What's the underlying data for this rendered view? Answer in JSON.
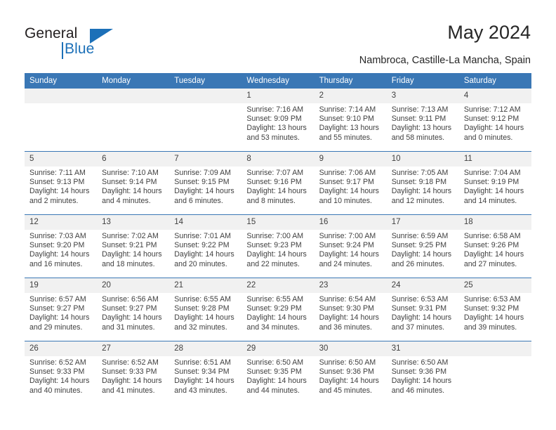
{
  "brand": {
    "name_part1": "General",
    "name_part2": "Blue"
  },
  "header": {
    "title": "May 2024",
    "subtitle": "Nambroca, Castille-La Mancha, Spain"
  },
  "colors": {
    "header_blue": "#3a77b5",
    "brand_blue": "#1c70b8",
    "daynum_band": "#f1f1f1",
    "text": "#3f3f3f"
  },
  "weekdays": [
    "Sunday",
    "Monday",
    "Tuesday",
    "Wednesday",
    "Thursday",
    "Friday",
    "Saturday"
  ],
  "labels": {
    "sunrise_prefix": "Sunrise:",
    "sunset_prefix": "Sunset:",
    "daylight_prefix": "Daylight:"
  },
  "weeks": [
    [
      {
        "day": "",
        "empty": true
      },
      {
        "day": "",
        "empty": true
      },
      {
        "day": "",
        "empty": true
      },
      {
        "day": "1",
        "sunrise": "Sunrise: 7:16 AM",
        "sunset": "Sunset: 9:09 PM",
        "daylight1": "Daylight: 13 hours",
        "daylight2": "and 53 minutes."
      },
      {
        "day": "2",
        "sunrise": "Sunrise: 7:14 AM",
        "sunset": "Sunset: 9:10 PM",
        "daylight1": "Daylight: 13 hours",
        "daylight2": "and 55 minutes."
      },
      {
        "day": "3",
        "sunrise": "Sunrise: 7:13 AM",
        "sunset": "Sunset: 9:11 PM",
        "daylight1": "Daylight: 13 hours",
        "daylight2": "and 58 minutes."
      },
      {
        "day": "4",
        "sunrise": "Sunrise: 7:12 AM",
        "sunset": "Sunset: 9:12 PM",
        "daylight1": "Daylight: 14 hours",
        "daylight2": "and 0 minutes."
      }
    ],
    [
      {
        "day": "5",
        "sunrise": "Sunrise: 7:11 AM",
        "sunset": "Sunset: 9:13 PM",
        "daylight1": "Daylight: 14 hours",
        "daylight2": "and 2 minutes."
      },
      {
        "day": "6",
        "sunrise": "Sunrise: 7:10 AM",
        "sunset": "Sunset: 9:14 PM",
        "daylight1": "Daylight: 14 hours",
        "daylight2": "and 4 minutes."
      },
      {
        "day": "7",
        "sunrise": "Sunrise: 7:09 AM",
        "sunset": "Sunset: 9:15 PM",
        "daylight1": "Daylight: 14 hours",
        "daylight2": "and 6 minutes."
      },
      {
        "day": "8",
        "sunrise": "Sunrise: 7:07 AM",
        "sunset": "Sunset: 9:16 PM",
        "daylight1": "Daylight: 14 hours",
        "daylight2": "and 8 minutes."
      },
      {
        "day": "9",
        "sunrise": "Sunrise: 7:06 AM",
        "sunset": "Sunset: 9:17 PM",
        "daylight1": "Daylight: 14 hours",
        "daylight2": "and 10 minutes."
      },
      {
        "day": "10",
        "sunrise": "Sunrise: 7:05 AM",
        "sunset": "Sunset: 9:18 PM",
        "daylight1": "Daylight: 14 hours",
        "daylight2": "and 12 minutes."
      },
      {
        "day": "11",
        "sunrise": "Sunrise: 7:04 AM",
        "sunset": "Sunset: 9:19 PM",
        "daylight1": "Daylight: 14 hours",
        "daylight2": "and 14 minutes."
      }
    ],
    [
      {
        "day": "12",
        "sunrise": "Sunrise: 7:03 AM",
        "sunset": "Sunset: 9:20 PM",
        "daylight1": "Daylight: 14 hours",
        "daylight2": "and 16 minutes."
      },
      {
        "day": "13",
        "sunrise": "Sunrise: 7:02 AM",
        "sunset": "Sunset: 9:21 PM",
        "daylight1": "Daylight: 14 hours",
        "daylight2": "and 18 minutes."
      },
      {
        "day": "14",
        "sunrise": "Sunrise: 7:01 AM",
        "sunset": "Sunset: 9:22 PM",
        "daylight1": "Daylight: 14 hours",
        "daylight2": "and 20 minutes."
      },
      {
        "day": "15",
        "sunrise": "Sunrise: 7:00 AM",
        "sunset": "Sunset: 9:23 PM",
        "daylight1": "Daylight: 14 hours",
        "daylight2": "and 22 minutes."
      },
      {
        "day": "16",
        "sunrise": "Sunrise: 7:00 AM",
        "sunset": "Sunset: 9:24 PM",
        "daylight1": "Daylight: 14 hours",
        "daylight2": "and 24 minutes."
      },
      {
        "day": "17",
        "sunrise": "Sunrise: 6:59 AM",
        "sunset": "Sunset: 9:25 PM",
        "daylight1": "Daylight: 14 hours",
        "daylight2": "and 26 minutes."
      },
      {
        "day": "18",
        "sunrise": "Sunrise: 6:58 AM",
        "sunset": "Sunset: 9:26 PM",
        "daylight1": "Daylight: 14 hours",
        "daylight2": "and 27 minutes."
      }
    ],
    [
      {
        "day": "19",
        "sunrise": "Sunrise: 6:57 AM",
        "sunset": "Sunset: 9:27 PM",
        "daylight1": "Daylight: 14 hours",
        "daylight2": "and 29 minutes."
      },
      {
        "day": "20",
        "sunrise": "Sunrise: 6:56 AM",
        "sunset": "Sunset: 9:27 PM",
        "daylight1": "Daylight: 14 hours",
        "daylight2": "and 31 minutes."
      },
      {
        "day": "21",
        "sunrise": "Sunrise: 6:55 AM",
        "sunset": "Sunset: 9:28 PM",
        "daylight1": "Daylight: 14 hours",
        "daylight2": "and 32 minutes."
      },
      {
        "day": "22",
        "sunrise": "Sunrise: 6:55 AM",
        "sunset": "Sunset: 9:29 PM",
        "daylight1": "Daylight: 14 hours",
        "daylight2": "and 34 minutes."
      },
      {
        "day": "23",
        "sunrise": "Sunrise: 6:54 AM",
        "sunset": "Sunset: 9:30 PM",
        "daylight1": "Daylight: 14 hours",
        "daylight2": "and 36 minutes."
      },
      {
        "day": "24",
        "sunrise": "Sunrise: 6:53 AM",
        "sunset": "Sunset: 9:31 PM",
        "daylight1": "Daylight: 14 hours",
        "daylight2": "and 37 minutes."
      },
      {
        "day": "25",
        "sunrise": "Sunrise: 6:53 AM",
        "sunset": "Sunset: 9:32 PM",
        "daylight1": "Daylight: 14 hours",
        "daylight2": "and 39 minutes."
      }
    ],
    [
      {
        "day": "26",
        "sunrise": "Sunrise: 6:52 AM",
        "sunset": "Sunset: 9:33 PM",
        "daylight1": "Daylight: 14 hours",
        "daylight2": "and 40 minutes."
      },
      {
        "day": "27",
        "sunrise": "Sunrise: 6:52 AM",
        "sunset": "Sunset: 9:33 PM",
        "daylight1": "Daylight: 14 hours",
        "daylight2": "and 41 minutes."
      },
      {
        "day": "28",
        "sunrise": "Sunrise: 6:51 AM",
        "sunset": "Sunset: 9:34 PM",
        "daylight1": "Daylight: 14 hours",
        "daylight2": "and 43 minutes."
      },
      {
        "day": "29",
        "sunrise": "Sunrise: 6:50 AM",
        "sunset": "Sunset: 9:35 PM",
        "daylight1": "Daylight: 14 hours",
        "daylight2": "and 44 minutes."
      },
      {
        "day": "30",
        "sunrise": "Sunrise: 6:50 AM",
        "sunset": "Sunset: 9:36 PM",
        "daylight1": "Daylight: 14 hours",
        "daylight2": "and 45 minutes."
      },
      {
        "day": "31",
        "sunrise": "Sunrise: 6:50 AM",
        "sunset": "Sunset: 9:36 PM",
        "daylight1": "Daylight: 14 hours",
        "daylight2": "and 46 minutes."
      },
      {
        "day": "",
        "empty": true
      }
    ]
  ]
}
